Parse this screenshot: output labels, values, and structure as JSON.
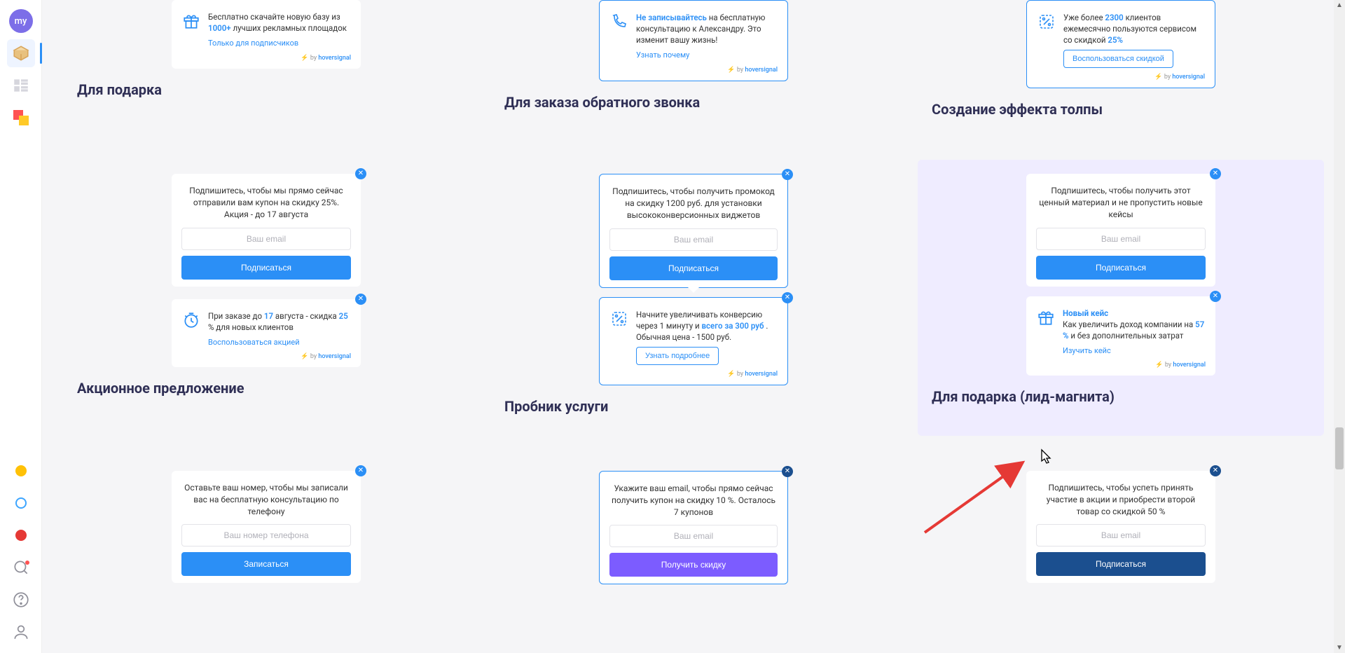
{
  "sidebar": {
    "avatar": "my"
  },
  "hoversignal": {
    "by": "by",
    "name": "hoversignal"
  },
  "common": {
    "email_ph": "Ваш email",
    "phone_ph": "Ваш номер телефона",
    "subscribe": "Подписаться",
    "signup": "Записаться",
    "get_discount": "Получить скидку"
  },
  "titles": {
    "r1c1": "Для подарка",
    "r1c2": "Для заказа обратного звонка",
    "r1c3": "Создание эффекта толпы",
    "r2c1": "Акционное предложение",
    "r2c2": "Пробник услуги",
    "r2c3": "Для подарка (лид-магнита)"
  },
  "top": {
    "c1": {
      "text_a": "Бесплатно скачайте новую базу из",
      "hl": "1000+",
      "text_b": "лучших рекламных площадок",
      "link": "Только для подписчиков"
    },
    "c2": {
      "hl": "Не записывайтесь",
      "text": "на бесплатную консультацию к Александру. Это изменит вашу жизнь!",
      "link": "Узнать почему"
    },
    "c3": {
      "text_a": "Уже более",
      "hl1": "2300",
      "text_b": "клиентов ежемесячно пользуются сервисом со скидкой",
      "hl2": "25%",
      "btn": "Воспользоваться скидкой"
    }
  },
  "mid": {
    "c1": {
      "card_text": "Подпишитесь, чтобы мы прямо сейчас отправили вам купон на скидку 25%. Акция - до 17 августа",
      "mini_a": "При заказе до",
      "mini_hl1": "17",
      "mini_b": "августа - скидка",
      "mini_hl2": "25",
      "mini_c": "% для новых клиентов",
      "mini_link": "Воспользоваться акцией"
    },
    "c2": {
      "card_text": "Подпишитесь, чтобы получить промокод на скидку 1200 руб. для установки высококонверсионных виджетов",
      "mini_a": "Начните увеличивать конверсию через 1 минуту и",
      "mini_hl1": "всего за 300 руб",
      "mini_b": ". Обычная цена - 1500 руб.",
      "mini_btn": "Узнать подробнее"
    },
    "c3": {
      "card_text": "Подпишитесь, чтобы получить этот ценный материал и не пропустить новые кейсы",
      "mini_title": "Новый кейс",
      "mini_a": "Как увеличить доход компании на",
      "mini_hl1": "57 %",
      "mini_b": "и без дополнительных затрат",
      "mini_link": "Изучить кейс"
    }
  },
  "bot": {
    "c1": {
      "text": "Оставьте ваш номер, чтобы мы записали вас на бесплатную консультацию по телефону"
    },
    "c2": {
      "text": "Укажите ваш email, чтобы прямо сейчас получить купон на скидку 10 %. Осталось 7 купонов"
    },
    "c3": {
      "text": "Подпишитесь, чтобы успеть принять участие в акции и приобрести второй товар со скидкой 50 %"
    }
  }
}
